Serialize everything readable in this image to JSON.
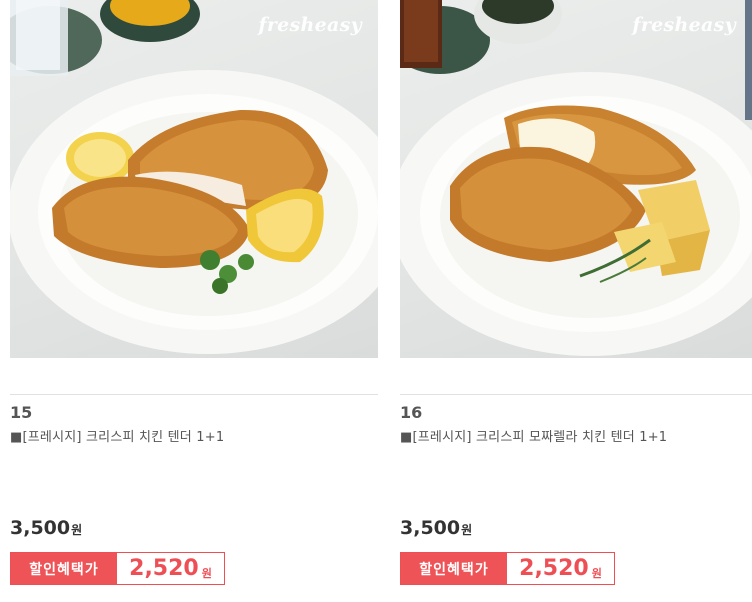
{
  "products": [
    {
      "number": "15",
      "name": "■[프레시지] 크리스피 치킨 텐더 1+1",
      "watermark": "fresheasy",
      "price": "3,500",
      "price_unit": "원",
      "discount_label": "할인혜택가",
      "discount_price": "2,520",
      "discount_unit": "원",
      "image_icon": "chicken-tender-photo"
    },
    {
      "number": "16",
      "name": "■[프레시지] 크리스피 모짜렐라 치킨 텐더 1+1",
      "watermark": "fresheasy",
      "price": "3,500",
      "price_unit": "원",
      "discount_label": "할인혜택가",
      "discount_price": "2,520",
      "discount_unit": "원",
      "image_icon": "mozzarella-chicken-tender-photo"
    }
  ],
  "colors": {
    "discount_accent": "#ee5357",
    "text": "#333333"
  }
}
